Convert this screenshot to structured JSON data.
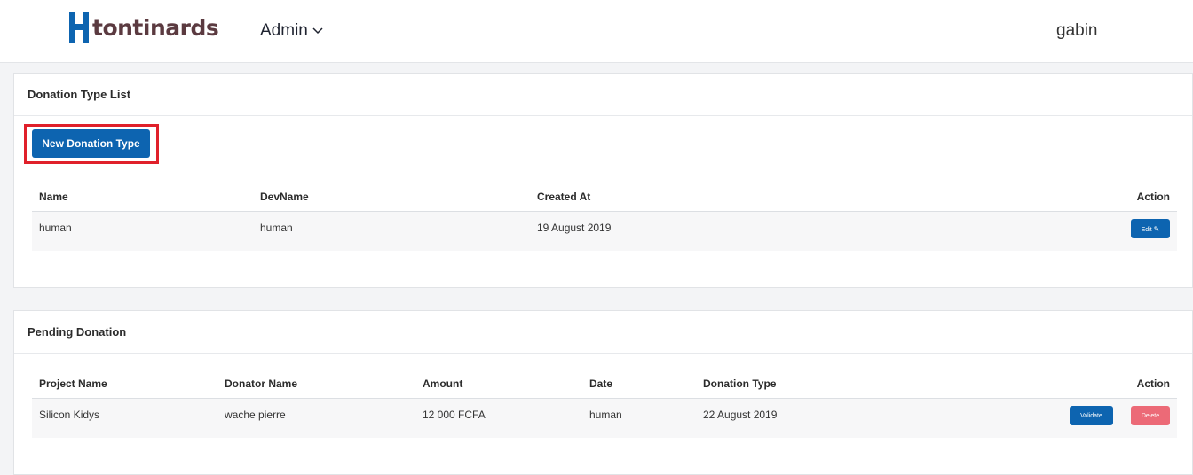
{
  "brand": {
    "name": "tontinards",
    "color": "#5b3a40",
    "mark_color": "#0d64b0"
  },
  "nav": {
    "admin_label": "Admin",
    "user": "gabin"
  },
  "donation_types": {
    "title": "Donation Type List",
    "new_button": "New Donation Type",
    "columns": [
      "Name",
      "DevName",
      "Created At",
      "Action"
    ],
    "rows": [
      {
        "name": "human",
        "devname": "human",
        "created_at": "19 August 2019",
        "edit_label": "Edit"
      }
    ]
  },
  "pending": {
    "title": "Pending Donation",
    "columns": [
      "Project Name",
      "Donator Name",
      "Amount",
      "Date",
      "Donation Type",
      "Action"
    ],
    "rows": [
      {
        "project": "Silicon Kidys",
        "donator": "wache pierre",
        "amount": "12 000 FCFA",
        "date": "human",
        "donation_type": "22 August 2019",
        "validate_label": "Validate",
        "delete_label": "Delete"
      }
    ]
  },
  "colors": {
    "primary": "#0d64b0",
    "danger": "#ec6a77",
    "highlight": "#e0202a"
  }
}
